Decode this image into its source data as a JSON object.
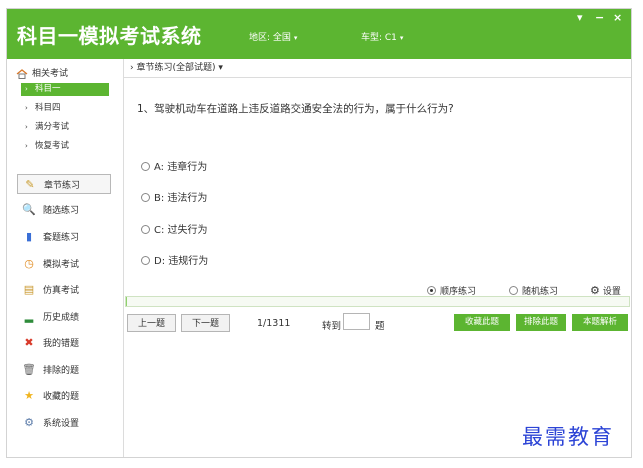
{
  "app": {
    "title": "科目一模拟考试系统",
    "region": "地区: 全国",
    "car_type": "车型: C1",
    "caret": "▾",
    "win_menu": "▾",
    "win_min": "−",
    "win_close": "×"
  },
  "sidebar": {
    "category_title": "相关考试",
    "subitems": [
      {
        "label": "科目一",
        "arrow": "›",
        "active": true
      },
      {
        "label": "科目四",
        "arrow": "›",
        "active": false
      },
      {
        "label": "满分考试",
        "arrow": "›",
        "active": false
      },
      {
        "label": "恢复考试",
        "arrow": "›",
        "active": false
      }
    ],
    "menu": [
      {
        "label": "章节练习",
        "icon": "✎"
      },
      {
        "label": "随选练习",
        "icon": "🔍"
      },
      {
        "label": "套题练习",
        "icon": "▮"
      },
      {
        "label": "模拟考试",
        "icon": "◷"
      },
      {
        "label": "仿真考试",
        "icon": "▤"
      },
      {
        "label": "历史成绩",
        "icon": "▂"
      },
      {
        "label": "我的错题",
        "icon": "✖"
      },
      {
        "label": "排除的题",
        "icon": "🗑"
      },
      {
        "label": "收藏的题",
        "icon": "★"
      },
      {
        "label": "系统设置",
        "icon": "⚙"
      }
    ]
  },
  "main": {
    "breadcrumb_arrow": "›",
    "breadcrumb": "章节练习(全部试题)",
    "breadcrumb_caret": "▾",
    "question": "1、驾驶机动车在道路上违反道路交通安全法的行为，属于什么行为?",
    "options": [
      "A: 违章行为",
      "B: 违法行为",
      "C: 过失行为",
      "D: 违规行为"
    ],
    "mode_sequential": "顺序练习",
    "mode_random": "随机练习",
    "settings": "设置",
    "settings_icon": "⚙",
    "progress_fraction": 0.0008,
    "prev": "上一题",
    "next": "下一题",
    "counter": "1/1311",
    "goto": "转到",
    "topic_unit": "题",
    "favorite": "收藏此题",
    "exclude": "排除此题",
    "explain": "本题解析"
  },
  "watermark": "最需教育",
  "colors": {
    "accent": "#5cb531",
    "watermark": "#2c44d6"
  }
}
